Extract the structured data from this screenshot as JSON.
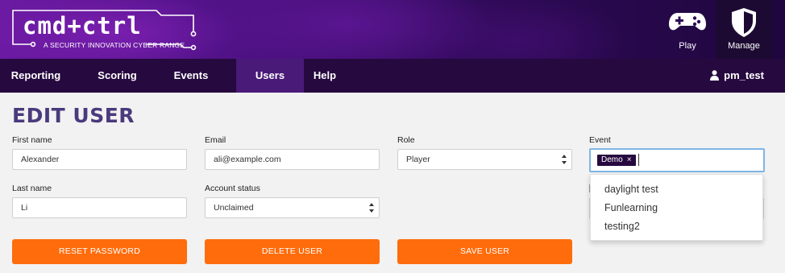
{
  "brand": {
    "logo_text": "cmd+ctrl",
    "tagline": "A SECURITY INNOVATION CYBER RANGE"
  },
  "top_actions": {
    "play_label": "Play",
    "play_icon": "gamepad-icon",
    "manage_label": "Manage",
    "manage_icon": "shield-icon"
  },
  "nav": {
    "items": [
      {
        "label": "Reporting"
      },
      {
        "label": "Scoring"
      },
      {
        "label": "Events"
      },
      {
        "label": "Users"
      },
      {
        "label": "Help"
      }
    ],
    "active": "Users",
    "user_label": "pm_test",
    "user_icon": "user-icon"
  },
  "page": {
    "title": "EDIT USER"
  },
  "form": {
    "first_name_label": "First name",
    "first_name_value": "Alexander",
    "last_name_label": "Last name",
    "last_name_value": "Li",
    "email_label": "Email",
    "email_value": "ali@example.com",
    "account_status_label": "Account status",
    "account_status_value": "Unclaimed",
    "role_label": "Role",
    "role_value": "Player",
    "event_label": "Event",
    "event_tag": "Demo",
    "event_tag_remove": "×",
    "event_options": [
      "daylight test",
      "Funlearning",
      "testing2"
    ]
  },
  "buttons": {
    "reset_password": "RESET PASSWORD",
    "delete_user": "DELETE USER",
    "save_user": "SAVE USER"
  },
  "colors": {
    "accent_orange": "#ff6c0c",
    "nav_bg": "#26093f",
    "nav_active": "#4a1a78",
    "title_color": "#4a3a7d",
    "focus_border": "#7fb5e6"
  }
}
